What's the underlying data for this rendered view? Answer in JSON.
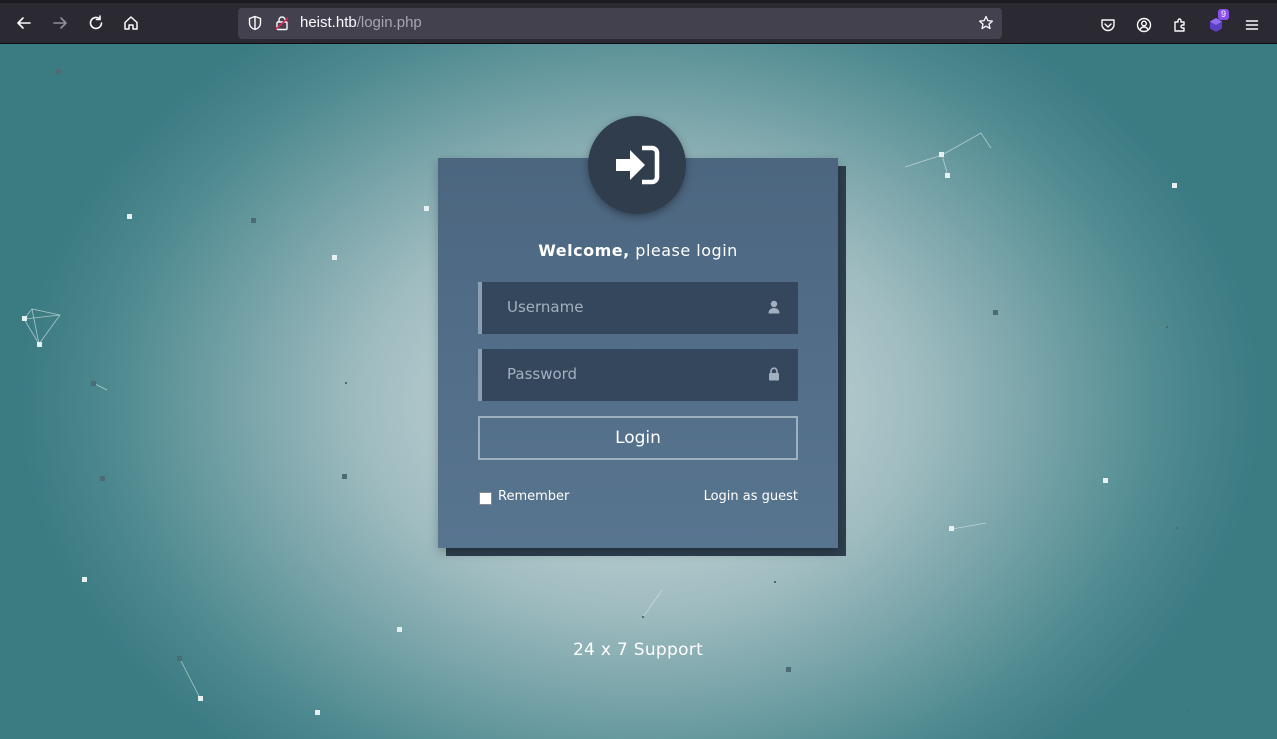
{
  "browser": {
    "url_host": "heist.htb",
    "url_path": "/login.php",
    "extension_badge": "9",
    "icons": [
      "back-icon",
      "forward-icon",
      "reload-icon",
      "home-icon",
      "shield-icon",
      "lock-icon",
      "star-icon",
      "pocket-icon",
      "account-icon",
      "extensions-icon",
      "extension-icon",
      "menu-icon"
    ]
  },
  "login": {
    "welcome_bold": "Welcome,",
    "welcome_rest": " please login",
    "username_placeholder": "Username",
    "password_placeholder": "Password",
    "login_button": "Login",
    "remember_label": "Remember",
    "remember_checked": false,
    "guest_link": "Login as guest",
    "icons": [
      "sign-in-icon",
      "user-icon",
      "lock-icon"
    ]
  },
  "footer": {
    "support_text": "24 x 7 Support"
  },
  "colors": {
    "card": "#587590",
    "field": "#34475d",
    "icon_circle": "#2f3d4d",
    "background": "#9fbcc0"
  }
}
